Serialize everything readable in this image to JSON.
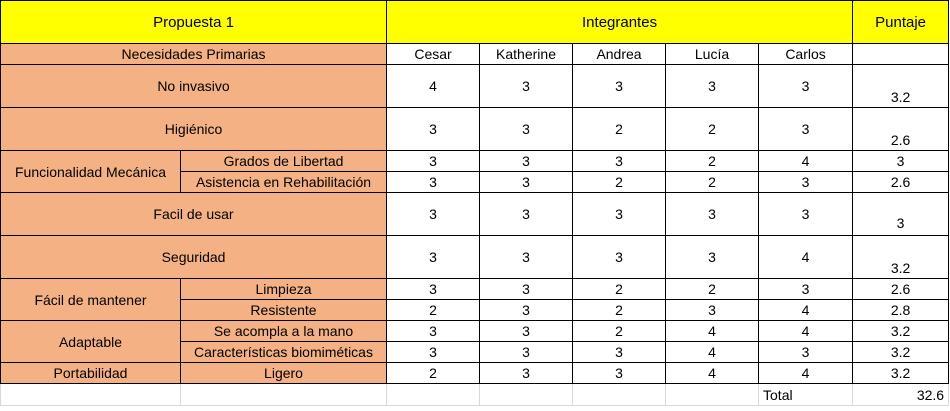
{
  "header": {
    "proposal": "Propuesta 1",
    "members_label": "Integrantes",
    "score_label": "Puntaje",
    "needs_label": "Necesidades Primarias"
  },
  "members": [
    "Cesar",
    "Katherine",
    "Andrea",
    "Lucía",
    "Carlos"
  ],
  "rows": [
    {
      "category": "No invasivo",
      "sub": "",
      "scores": [
        "4",
        "3",
        "3",
        "3",
        "3"
      ],
      "puntaje": "3.2"
    },
    {
      "category": "Higiénico",
      "sub": "",
      "scores": [
        "3",
        "3",
        "2",
        "2",
        "3"
      ],
      "puntaje": "2.6"
    },
    {
      "category": "Funcionalidad Mecánica",
      "sub": "Grados de Libertad",
      "scores": [
        "3",
        "3",
        "3",
        "2",
        "4"
      ],
      "puntaje": "3"
    },
    {
      "category": "",
      "sub": "Asistencia en Rehabilitación",
      "scores": [
        "3",
        "3",
        "2",
        "2",
        "3"
      ],
      "puntaje": "2.6"
    },
    {
      "category": "Facil de usar",
      "sub": "",
      "scores": [
        "3",
        "3",
        "3",
        "3",
        "3"
      ],
      "puntaje": "3"
    },
    {
      "category": "Seguridad",
      "sub": "",
      "scores": [
        "3",
        "3",
        "3",
        "3",
        "4"
      ],
      "puntaje": "3.2"
    },
    {
      "category": "Fácil de mantener",
      "sub": "Limpieza",
      "scores": [
        "3",
        "3",
        "2",
        "2",
        "3"
      ],
      "puntaje": "2.6"
    },
    {
      "category": "",
      "sub": "Resistente",
      "scores": [
        "2",
        "3",
        "2",
        "3",
        "4"
      ],
      "puntaje": "2.8"
    },
    {
      "category": "Adaptable",
      "sub": "Se acompla a la mano",
      "scores": [
        "3",
        "3",
        "2",
        "4",
        "4"
      ],
      "puntaje": "3.2"
    },
    {
      "category": "",
      "sub": "Características biomiméticas",
      "scores": [
        "3",
        "3",
        "3",
        "4",
        "3"
      ],
      "puntaje": "3.2"
    },
    {
      "category": "Portabilidad",
      "sub": "Ligero",
      "scores": [
        "2",
        "3",
        "3",
        "4",
        "4"
      ],
      "puntaje": "3.2"
    }
  ],
  "total": {
    "label": "Total",
    "value": "32.6"
  },
  "colors": {
    "header": "#ffff00",
    "needs": "#f4b183"
  }
}
